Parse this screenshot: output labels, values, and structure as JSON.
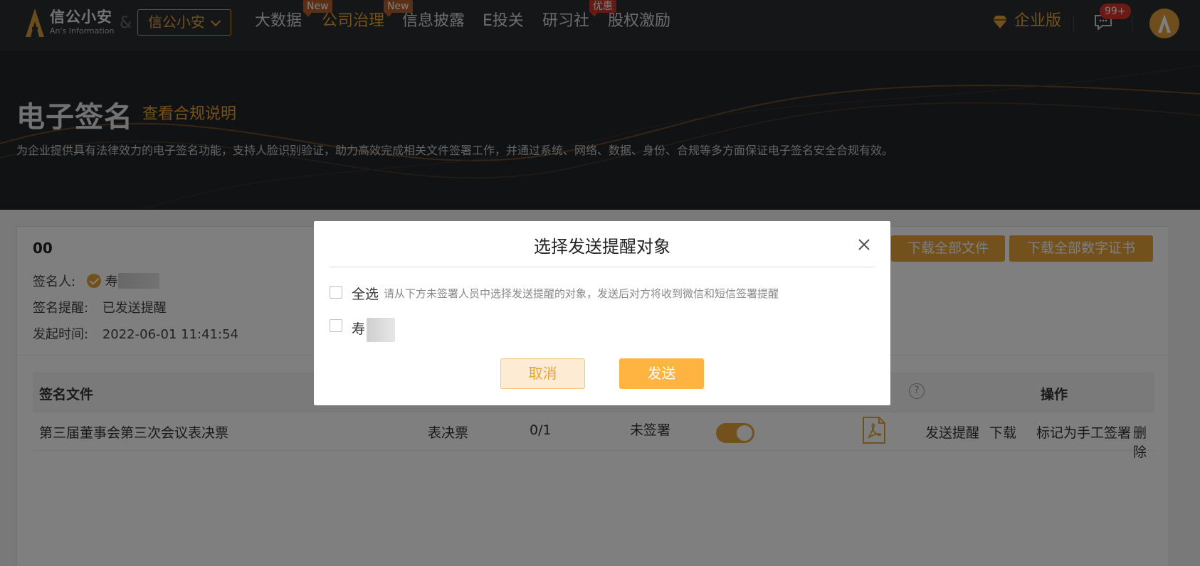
{
  "header": {
    "brand_name": "信公小安",
    "brand_sub": "An's Information",
    "amp": "&",
    "org_select": "信公小安",
    "nav": [
      {
        "label": "大数据",
        "badge": ""
      },
      {
        "label": "公司治理",
        "badge": "New"
      },
      {
        "label": "信息披露",
        "badge": "New"
      },
      {
        "label": "E投关",
        "badge": ""
      },
      {
        "label": "研习社",
        "badge": ""
      },
      {
        "label": "股权激励",
        "badge": "优惠"
      }
    ],
    "active_nav": "公司治理",
    "enterprise": "企业版",
    "message_count": "99+",
    "colors": {
      "accent": "#e7a33a",
      "nav_bg": "#2b2d31",
      "badge_red": "#d9342b"
    }
  },
  "banner": {
    "title": "电子签名",
    "link": "查看合规说明",
    "description": "为企业提供具有法律效力的电子签名功能，支持人脸识别验证，助力高效完成相关文件签署工作，并通过系统、网络、数据、身份、合规等多方面保证电子签名安全合规有效。"
  },
  "document": {
    "code": "00",
    "signer_label": "签名人:",
    "signer_name": "寿",
    "reminder_label": "签名提醒:",
    "reminder_value": "已发送提醒",
    "start_label": "发起时间:",
    "start_value": "2022-06-01 11:41:54",
    "buttons": {
      "download_all": "下载全部文件",
      "download_certs": "下载全部数字证书"
    }
  },
  "table": {
    "headers": {
      "file": "签名文件",
      "op": "操作"
    },
    "rows": [
      {
        "file": "第三届董事会第三次会议表决票",
        "type": "表决票",
        "progress": "0/1",
        "status": "未签署",
        "toggle_on": true,
        "ops": [
          "发送提醒",
          "下载",
          "标记为手工签署",
          "删除"
        ]
      }
    ]
  },
  "dialog": {
    "title": "选择发送提醒对象",
    "select_all": "全选",
    "hint": "请从下方未签署人员中选择发送提醒的对象，发送后对方将收到微信和短信签署提醒",
    "person": "寿",
    "cancel": "取消",
    "send": "发送"
  }
}
